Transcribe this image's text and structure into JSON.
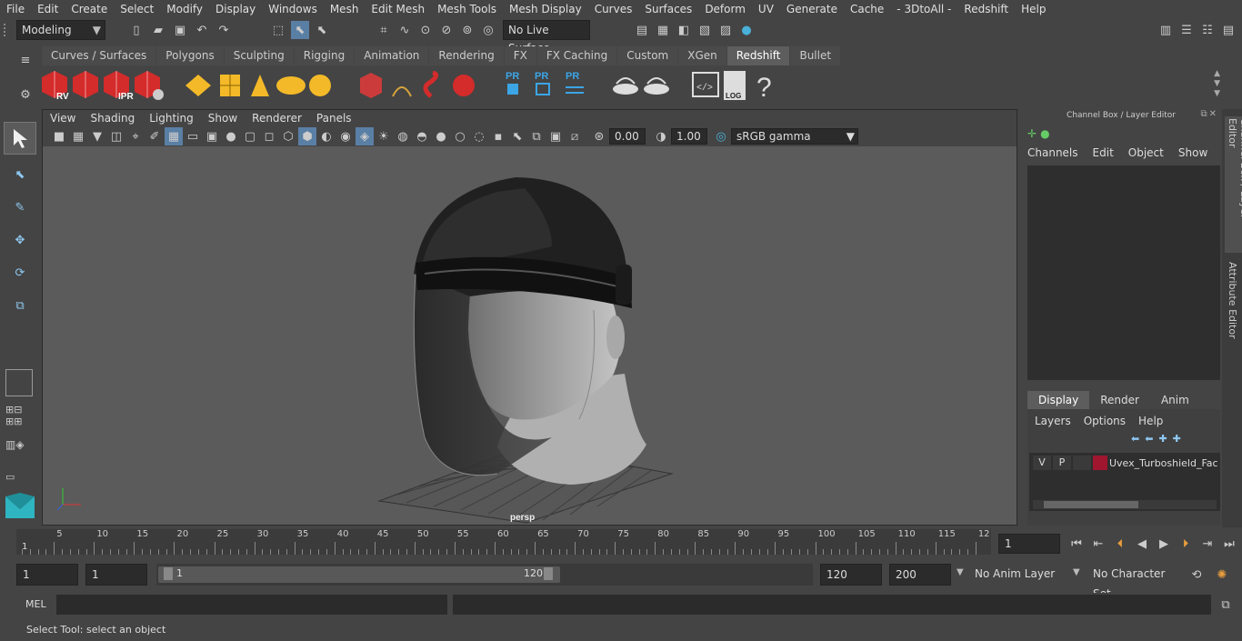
{
  "menubar": [
    "File",
    "Edit",
    "Create",
    "Select",
    "Modify",
    "Display",
    "Windows",
    "Mesh",
    "Edit Mesh",
    "Mesh Tools",
    "Mesh Display",
    "Curves",
    "Surfaces",
    "Deform",
    "UV",
    "Generate",
    "Cache",
    "- 3DtoAll -",
    "Redshift",
    "Help"
  ],
  "statusline": {
    "mode": "Modeling",
    "live_surface": "No Live Surface"
  },
  "shelf_tabs": [
    "Curves / Surfaces",
    "Polygons",
    "Sculpting",
    "Rigging",
    "Animation",
    "Rendering",
    "FX",
    "FX Caching",
    "Custom",
    "XGen",
    "Redshift",
    "Bullet"
  ],
  "shelf_active": "Redshift",
  "shelf_icons": {
    "rv": "RV",
    "ipr": "IPR",
    "pr": "PR",
    "log": "LOG",
    "help": "?"
  },
  "viewport": {
    "menus": [
      "View",
      "Shading",
      "Lighting",
      "Show",
      "Renderer",
      "Panels"
    ],
    "exposure": "0.00",
    "gamma": "1.00",
    "colorspace": "sRGB gamma",
    "camera_label": "persp"
  },
  "channelbox": {
    "title": "Channel Box / Layer Editor",
    "menus": [
      "Channels",
      "Edit",
      "Object",
      "Show"
    ],
    "layer_tabs": [
      "Display",
      "Render",
      "Anim"
    ],
    "layer_menus": [
      "Layers",
      "Options",
      "Help"
    ],
    "layer_row": {
      "v": "V",
      "p": "P",
      "name": "Uvex_Turboshield_Fac",
      "color": "#a0162e"
    }
  },
  "sidetabs": [
    "Channel Box / Layer Editor",
    "Attribute Editor"
  ],
  "timeline": {
    "ticks": [
      "5",
      "10",
      "15",
      "20",
      "25",
      "30",
      "35",
      "40",
      "45",
      "50",
      "55",
      "60",
      "65",
      "70",
      "75",
      "80",
      "85",
      "90",
      "95",
      "100",
      "105",
      "110",
      "115",
      "12"
    ],
    "current_left": "1",
    "current_frame": "1"
  },
  "range": {
    "start": "1",
    "start2": "1",
    "slider_start": "1",
    "slider_end": "120",
    "end": "120",
    "max": "200",
    "anim_layer": "No Anim Layer",
    "character_set": "No Character Set"
  },
  "command": {
    "lang": "MEL"
  },
  "helpline": "Select Tool: select an object"
}
